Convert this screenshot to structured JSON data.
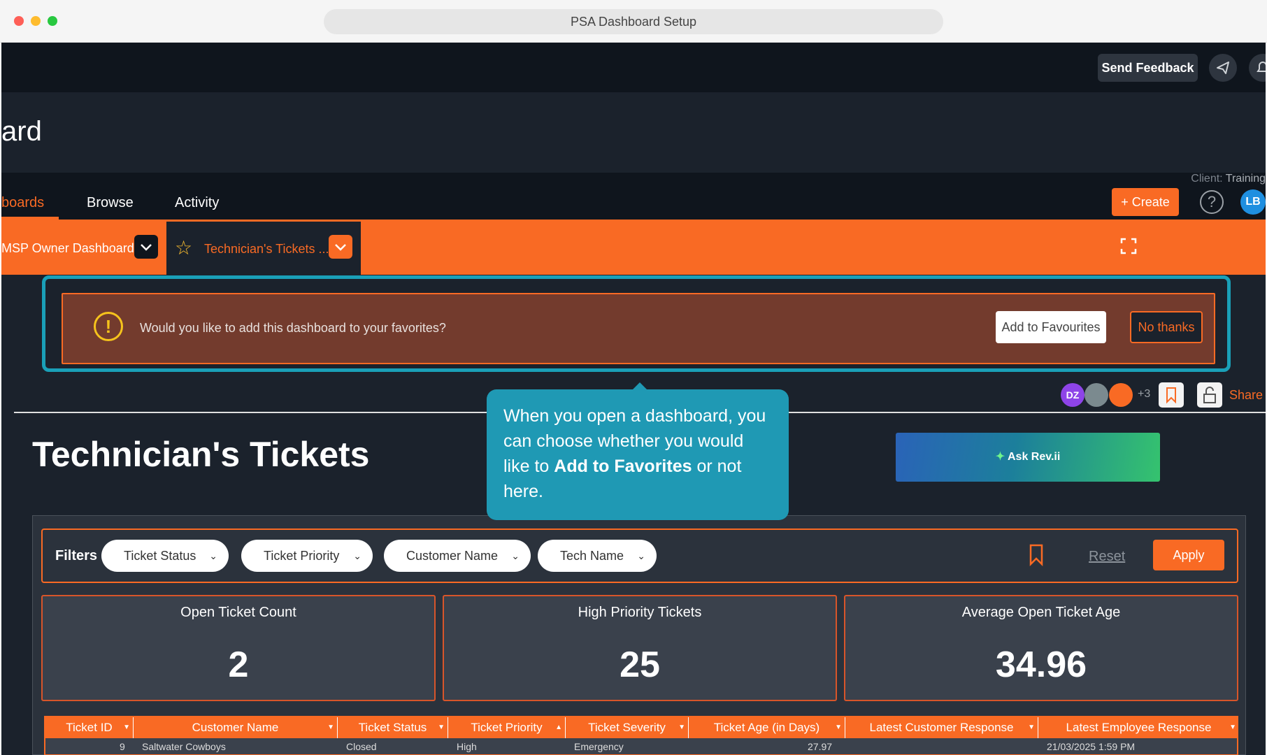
{
  "window": {
    "title": "PSA Dashboard Setup"
  },
  "topbar": {
    "feedback_label": "Send Feedback"
  },
  "header": {
    "title": "ard"
  },
  "nav": {
    "client_label": "Client:",
    "client_name": "Training",
    "tabs": [
      {
        "label": "boards"
      },
      {
        "label": "Browse"
      },
      {
        "label": "Activity"
      }
    ],
    "create_label": "+  Create",
    "help_glyph": "?",
    "user_initials": "LB"
  },
  "dashboard_tabs": [
    {
      "label": "MSP Owner Dashboard"
    },
    {
      "label": "Technician's Tickets ..."
    }
  ],
  "favorites_banner": {
    "text": "Would you like to add this dashboard to your favorites?",
    "add_label": "Add to Favourites",
    "decline_label": "No thanks"
  },
  "collaborators": {
    "first_initials": "DZ",
    "extra_count": "+3",
    "share_label": "Share"
  },
  "page": {
    "title": "Technician's Tickets",
    "ask_label": "Ask Rev.ii"
  },
  "tooltip": {
    "part1": "When you open a dashboard, you can choose whether you would like to ",
    "bold": "Add to Favorites",
    "part2": " or not here."
  },
  "filters": {
    "label": "Filters",
    "pills": [
      "Ticket Status",
      "Ticket Priority",
      "Customer Name",
      "Tech Name"
    ],
    "reset_label": "Reset",
    "apply_label": "Apply"
  },
  "kpis": [
    {
      "title": "Open Ticket Count",
      "value": "2"
    },
    {
      "title": "High Priority Tickets",
      "value": "25"
    },
    {
      "title": "Average Open Ticket Age",
      "value": "34.96"
    }
  ],
  "table": {
    "columns": [
      "Ticket ID",
      "Customer Name",
      "Ticket Status",
      "Ticket Priority",
      "Ticket Severity",
      "Ticket Age (in Days)",
      "Latest Customer Response",
      "Latest Employee Response"
    ],
    "rows": [
      [
        "9",
        "Saltwater Cowboys",
        "Closed",
        "High",
        "Emergency",
        "27.97",
        "",
        "21/03/2025 1:59 PM"
      ]
    ]
  },
  "colors": {
    "accent": "#f96a24",
    "highlight": "#1aa0b8",
    "background": "#1b222c"
  }
}
